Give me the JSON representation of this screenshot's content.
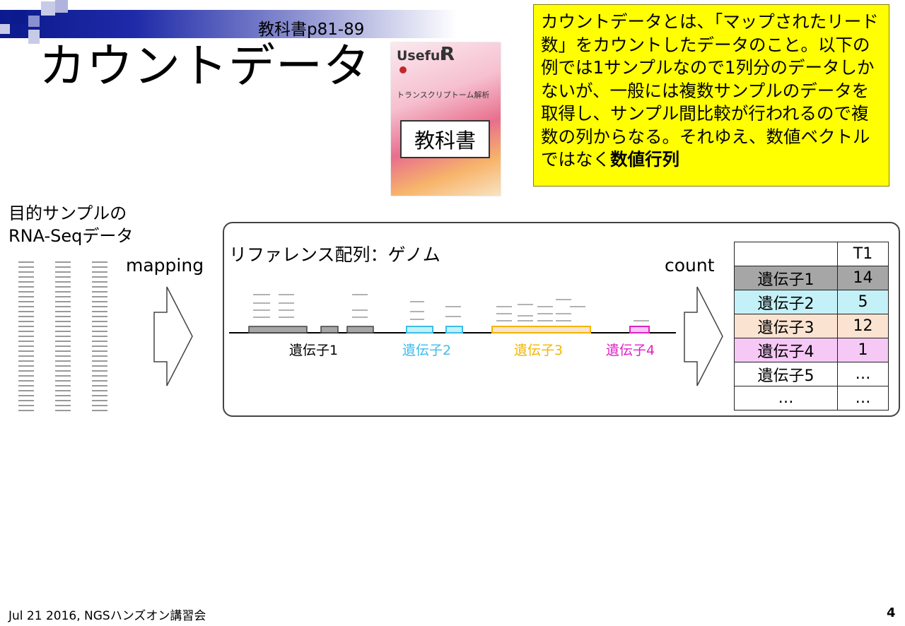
{
  "header": {
    "reference": "教科書p81-89",
    "title": "カウントデータ"
  },
  "book": {
    "brand": "Useful",
    "brand_letter": "R",
    "subtitle": "トランスクリプトーム解析",
    "label": "教科書"
  },
  "callout": {
    "text_before": "カウントデータとは、「マップされたリード数」をカウントしたデータのこと。以下の例では1サンプルなので1列分のデータしかないが、一般には複数サンプルのデータを取得し、サンプル間比較が行われるので複数の列からなる。それゆえ、数値ベクトルではなく",
    "text_bold": "数値行列"
  },
  "diagram": {
    "sample_label_line1": "目的サンプルの",
    "sample_label_line2": "RNA-Seqデータ",
    "mapping_label": "mapping",
    "count_label": "count",
    "genome_label": "リファレンス配列：ゲノム",
    "genes": [
      {
        "label": "遺伝子1",
        "color": "#000000"
      },
      {
        "label": "遺伝子2",
        "color": "#3cbde8"
      },
      {
        "label": "遺伝子3",
        "color": "#f2b600"
      },
      {
        "label": "遺伝子4",
        "color": "#e020c8"
      }
    ]
  },
  "count_table": {
    "header": [
      "",
      "T1"
    ],
    "rows": [
      {
        "gene": "遺伝子1",
        "value": "14",
        "color": "#a6a6a6"
      },
      {
        "gene": "遺伝子2",
        "value": "5",
        "color": "#c4f1f7"
      },
      {
        "gene": "遺伝子3",
        "value": "12",
        "color": "#fbe3d2"
      },
      {
        "gene": "遺伝子4",
        "value": "1",
        "color": "#f6c8f6"
      },
      {
        "gene": "遺伝子5",
        "value": "…",
        "color": "#ffffff"
      },
      {
        "gene": "…",
        "value": "…",
        "color": "#ffffff"
      }
    ]
  },
  "footer": {
    "text": "Jul 21 2016, NGSハンズオン講習会",
    "page": "4"
  }
}
